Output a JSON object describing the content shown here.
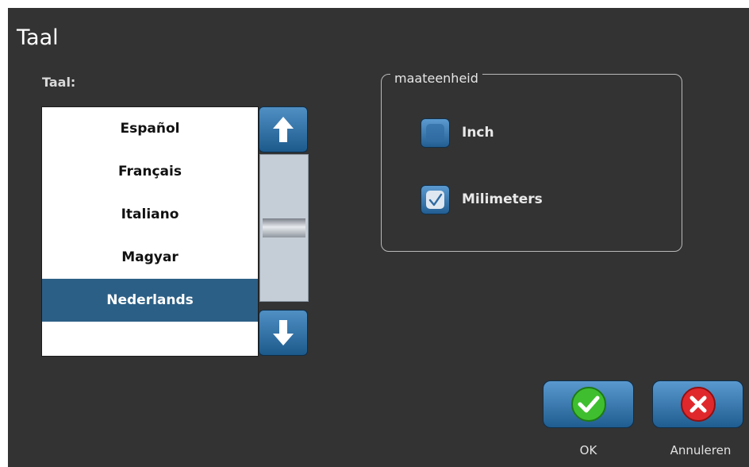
{
  "dialog": {
    "title": "Taal"
  },
  "language_list": {
    "label": "Taal:",
    "items": [
      {
        "label": "Español",
        "selected": false
      },
      {
        "label": "Français",
        "selected": false
      },
      {
        "label": "Italiano",
        "selected": false
      },
      {
        "label": "Magyar",
        "selected": false
      },
      {
        "label": "Nederlands",
        "selected": true
      }
    ],
    "scroll_up_icon": "arrow-up-icon",
    "scroll_down_icon": "arrow-down-icon"
  },
  "units": {
    "legend": "maateenheid",
    "options": [
      {
        "label": "Inch",
        "checked": false
      },
      {
        "label": "Milimeters",
        "checked": true
      }
    ]
  },
  "buttons": {
    "ok_label": "OK",
    "ok_icon": "checkmark-icon",
    "cancel_label": "Annuleren",
    "cancel_icon": "close-icon"
  },
  "colors": {
    "background": "#333333",
    "selection": "#2c5f85",
    "button_blue": "#2f6ea3",
    "ok_green": "#3fbf2f",
    "cancel_red": "#e0282c"
  }
}
